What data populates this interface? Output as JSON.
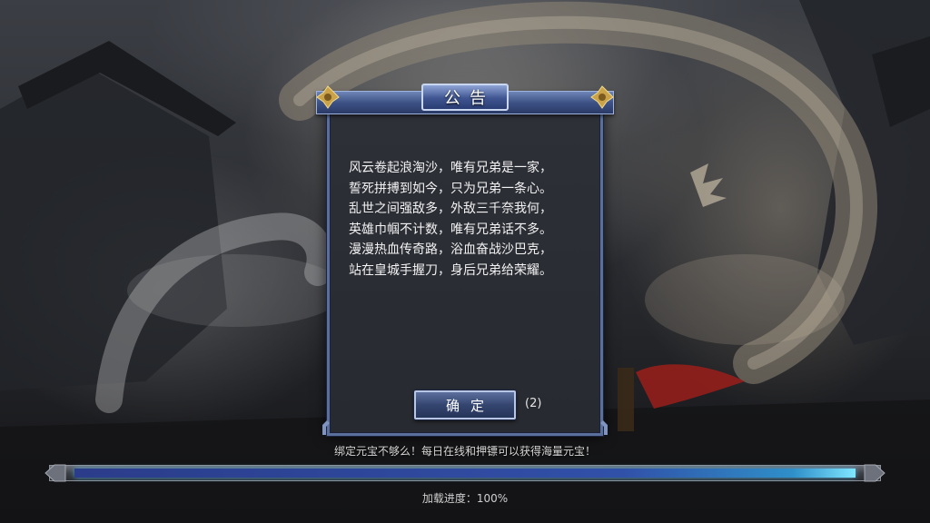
{
  "dialog": {
    "title": "公告",
    "lines": [
      "风云卷起浪淘沙，唯有兄弟是一家，",
      "誓死拼搏到如今，只为兄弟一条心。",
      "乱世之间强敌多，外敌三千奈我何，",
      "英雄巾帼不计数，唯有兄弟话不多。",
      "漫漫热血传奇路，浴血奋战沙巴克，",
      "站在皇城手握刀，身后兄弟给荣耀。"
    ],
    "confirm_label": "确定",
    "countdown": "(2)"
  },
  "footer": {
    "tip": "绑定元宝不够么！每日在线和押镖可以获得海量元宝！",
    "progress_label": "加载进度：100%",
    "progress_value": 100
  },
  "colors": {
    "frame_blue": "#5a6f9c",
    "progress_blue": "#3150a8",
    "progress_glow": "#7fe6ff"
  }
}
